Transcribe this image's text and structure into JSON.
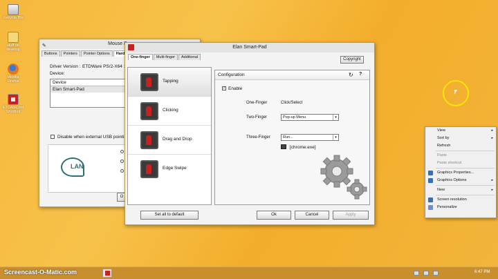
{
  "desktop_icons": [
    {
      "label": "Recycle Bin"
    },
    {
      "label": "stuff on desktop"
    },
    {
      "label": "Mozilla Firefox"
    },
    {
      "label": "ETDAniConf Shortcut"
    }
  ],
  "mouse_window": {
    "title": "Mouse Pro",
    "tabs": [
      "Buttons",
      "Pointers",
      "Pointer Options",
      "Hardw"
    ],
    "driver_label": "Driver Version :",
    "driver_value": "ETDWare PS/2-X64 11",
    "device_label": "Device:",
    "device_column": "Device",
    "device_row": "Elan Smart-Pad",
    "disable_label": "Disable when external USB pointing de",
    "logo_text": "LAN",
    "ok_partial": "O"
  },
  "elan_window": {
    "title": "Elan Smart-Pad",
    "tabs": [
      "One-finger",
      "Multi-finger",
      "Additional"
    ],
    "copyright_label": "Copyright",
    "items": [
      "Tapping",
      "Clicking",
      "Drag and Drop",
      "Edge Swipe"
    ],
    "config_title": "Configuration",
    "refresh_icon": "refresh-icon",
    "help_label": "?",
    "enable_label": "Enable",
    "rows": [
      {
        "label": "One-Finger",
        "value": "Click/Select"
      },
      {
        "label": "Two-Finger",
        "value": "Pop-up Menu"
      },
      {
        "label": "Three-Finger",
        "value": "Run..."
      }
    ],
    "run_target": "[chrome.exe]",
    "set_default_label": "Set all to default",
    "ok_label": "Ok",
    "cancel_label": "Cancel",
    "apply_label": "Apply"
  },
  "context_menu": {
    "items": [
      {
        "label": "View",
        "submenu": true,
        "disabled": false
      },
      {
        "label": "Sort by",
        "submenu": true,
        "disabled": false
      },
      {
        "label": "Refresh",
        "submenu": false,
        "disabled": false
      },
      {
        "label": "Paste",
        "submenu": false,
        "disabled": true
      },
      {
        "label": "Paste shortcut",
        "submenu": false,
        "disabled": true
      },
      {
        "label": "Graphics Properties...",
        "submenu": false,
        "disabled": false
      },
      {
        "label": "Graphics Options",
        "submenu": true,
        "disabled": false
      },
      {
        "label": "New",
        "submenu": true,
        "disabled": false
      },
      {
        "label": "Screen resolution",
        "submenu": false,
        "disabled": false
      },
      {
        "label": "Personalize",
        "submenu": false,
        "disabled": false
      }
    ]
  },
  "taskbar": {
    "watermark": "Screencast-O-Matic.com",
    "clock": "6:47 PM"
  },
  "colors": {
    "desktop": "#f4b53a",
    "accent_red": "#c8211f",
    "cursor_highlight": "#ffe600"
  }
}
